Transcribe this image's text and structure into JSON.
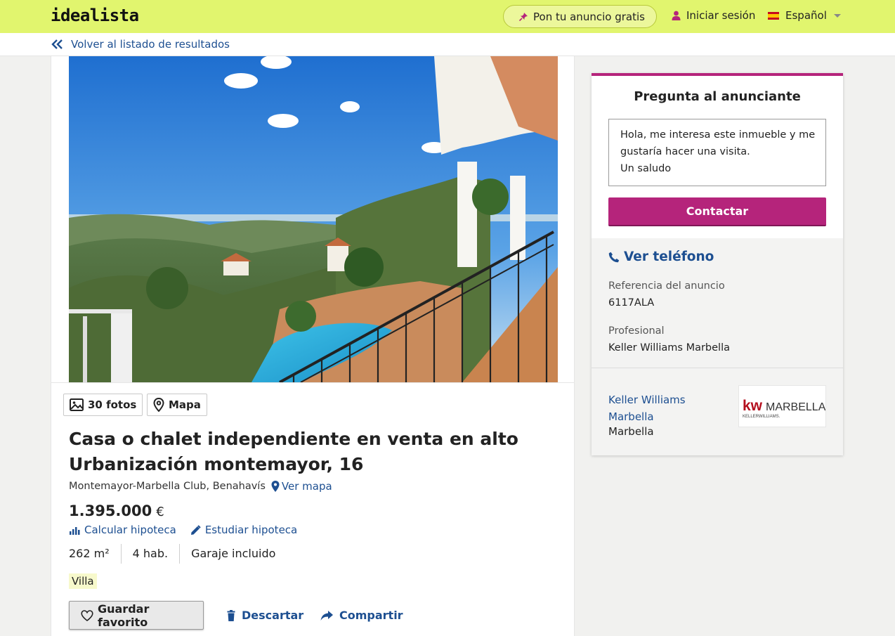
{
  "header": {
    "logo": "idealista",
    "post_ad_label": "Pon tu anuncio gratis",
    "login_label": "Iniciar sesión",
    "language_label": "Español"
  },
  "nav": {
    "back_label": "Volver al listado de resultados"
  },
  "listing": {
    "photos_label": "30 fotos",
    "map_label": "Mapa",
    "title": "Casa o chalet independiente en venta en alto Urbanización montemayor, 16",
    "location": "Montemayor-Marbella Club, Benahavís",
    "see_map_label": "Ver mapa",
    "price": "1.395.000",
    "currency": "€",
    "calc_mortgage_label": "Calcular hipoteca",
    "study_mortgage_label": "Estudiar hipoteca",
    "features": [
      "262 m²",
      "4 hab.",
      "Garaje incluido"
    ],
    "tag": "Villa",
    "favorite_label": "Guardar favorito",
    "discard_label": "Descartar",
    "share_label": "Compartir"
  },
  "contact": {
    "title": "Pregunta al anunciante",
    "message_lines": [
      "Hola, me interesa este inmueble y me",
      "gustaría hacer una visita.",
      "Un saludo"
    ],
    "contact_button_label": "Contactar",
    "phone_label": "Ver teléfono",
    "reference_label": "Referencia del anuncio",
    "reference_value": "6117ALA",
    "professional_label": "Profesional",
    "professional_value": "Keller Williams Marbella",
    "agency_name": "Keller Williams Marbella",
    "agency_city": "Marbella",
    "agency_logo_text": "kw MARBELLA",
    "agency_logo_subtext": "KELLERWILLIAMS."
  },
  "colors": {
    "header_bg": "#e1f56e",
    "link_blue": "#1d4f91",
    "accent_magenta": "#b5247b"
  }
}
